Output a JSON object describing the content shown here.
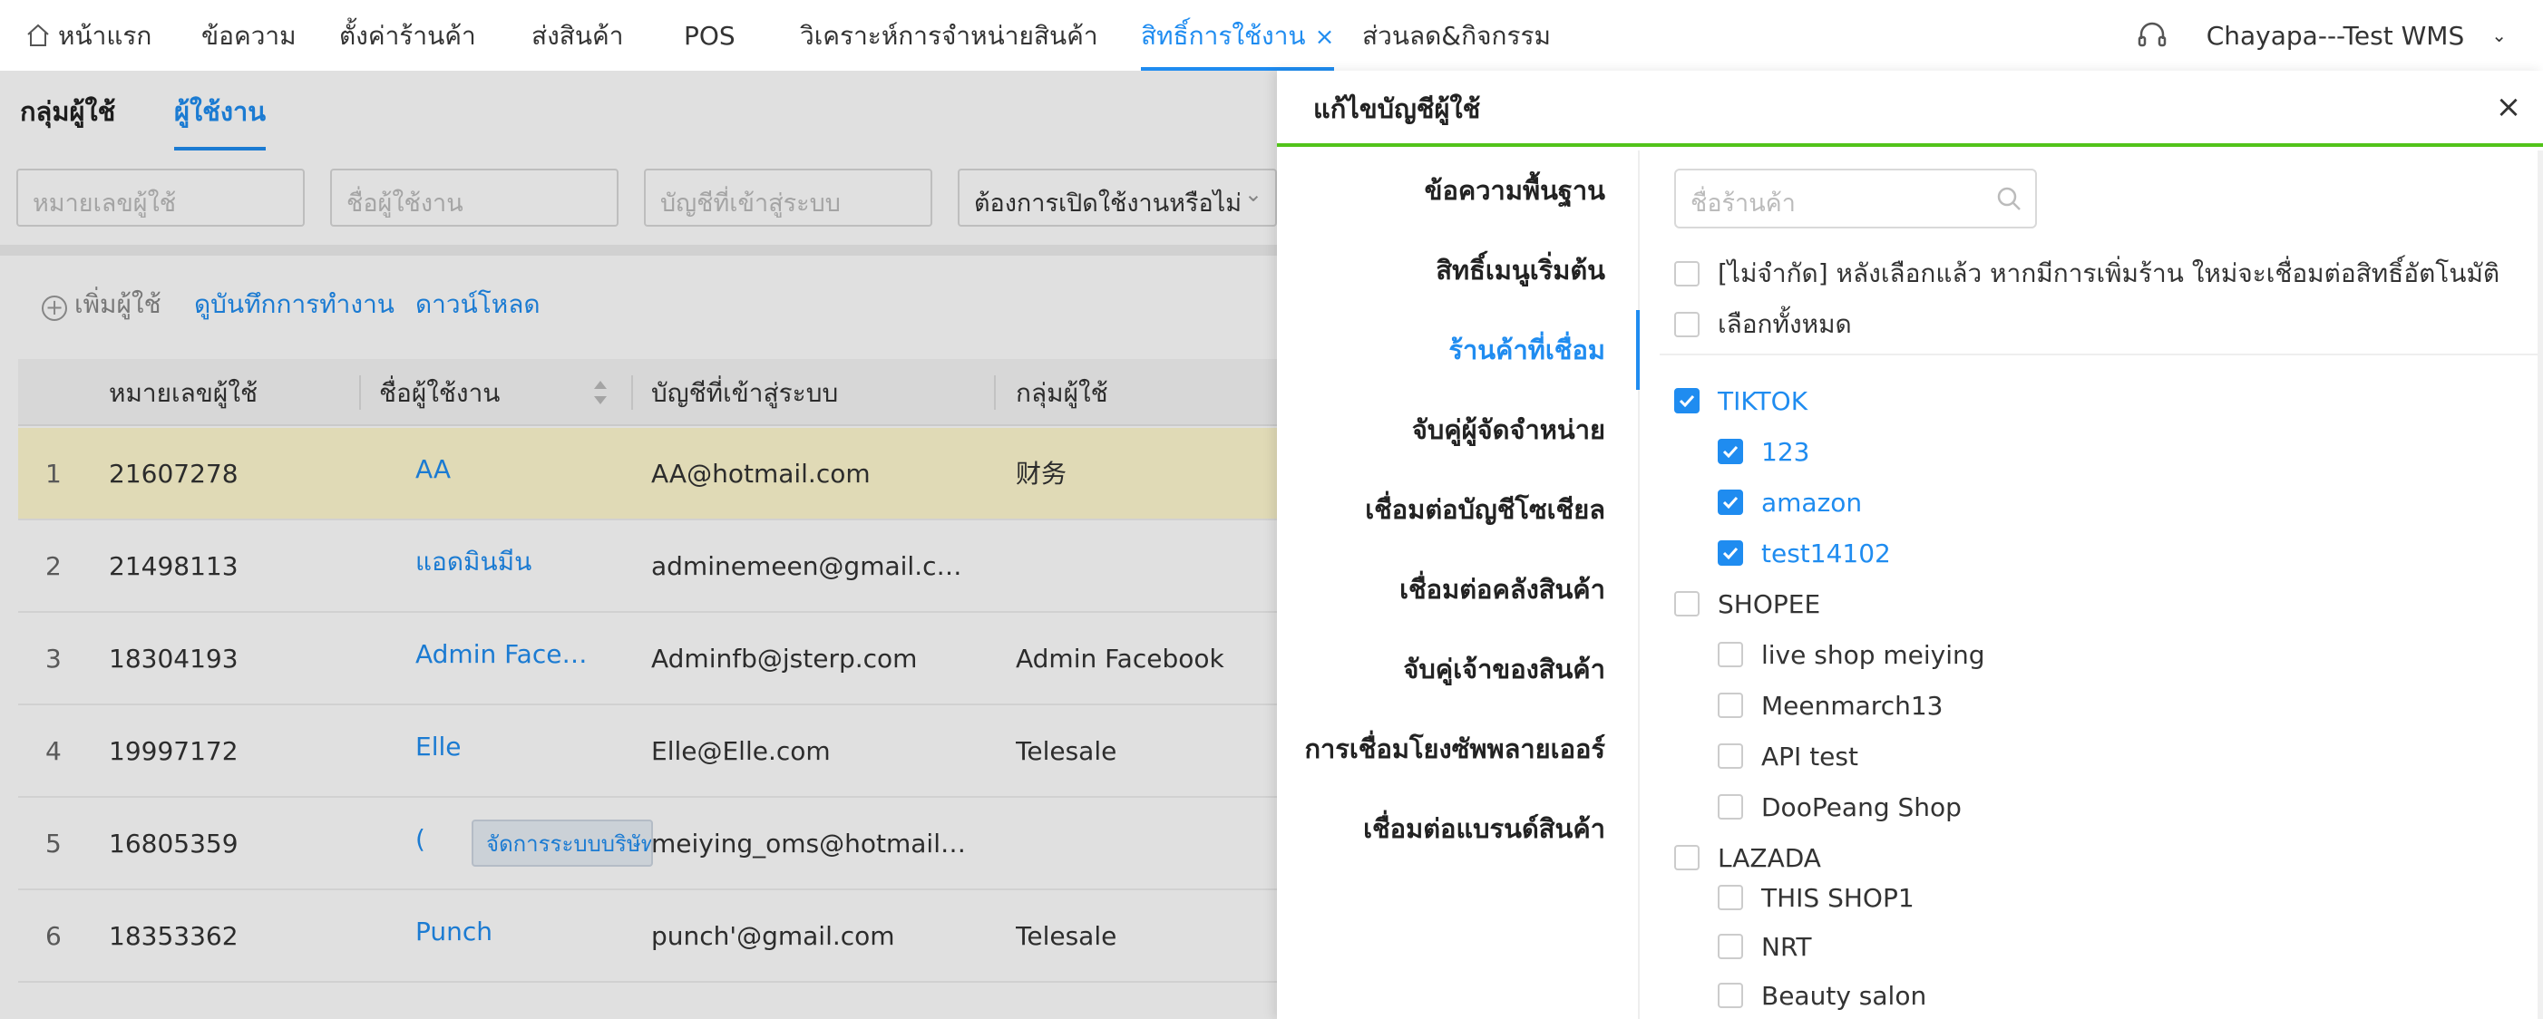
{
  "nav": {
    "home": "หน้าแรก",
    "items": [
      "ข้อความ",
      "ตั้งค่าร้านค้า",
      "ส่งสินค้า",
      "POS",
      "วิเคราะห์การจำหน่ายสินค้า"
    ],
    "active": "สิทธิ์การใช้งาน",
    "active_close": "×",
    "after": "ส่วนลด&กิจกรรม",
    "user": "Chayapa---Test WMS"
  },
  "subtabs": [
    "กลุ่มผู้ใช้",
    "ผู้ใช้งาน"
  ],
  "filters": {
    "user_id_placeholder": "หมายเลขผู้ใช้",
    "user_name_placeholder": "ชื่อผู้ใช้งาน",
    "login_placeholder": "บัญชีที่เข้าสู่ระบบ",
    "enable_select": "ต้องการเปิดใช้งานหรือไม่"
  },
  "actions": {
    "add_user": "เพิ่มผู้ใช้",
    "view_log": "ดูบันทึกการทำงาน",
    "download": "ดาวน์โหลด"
  },
  "table": {
    "headers": [
      "หมายเลขผู้ใช้",
      "ชื่อผู้ใช้งาน",
      "บัญชีที่เข้าสู่ระบบ",
      "กลุ่มผู้ใช้"
    ],
    "rows": [
      {
        "idx": "1",
        "id": "21607278",
        "name": "AA",
        "login": "AA@hotmail.com",
        "group": "财务"
      },
      {
        "idx": "2",
        "id": "21498113",
        "name": "แอดมินมีน",
        "login": "adminemeen@gmail.c…",
        "group": ""
      },
      {
        "idx": "3",
        "id": "18304193",
        "name": "Admin Face…",
        "login": "Adminfb@jsterp.com",
        "group": "Admin Facebook"
      },
      {
        "idx": "4",
        "id": "19997172",
        "name": "Elle",
        "login": "Elle@Elle.com",
        "group": "Telesale"
      },
      {
        "idx": "5",
        "id": "16805359",
        "name": "(",
        "login": "meiying_oms@hotmail…",
        "group": ""
      },
      {
        "idx": "6",
        "id": "18353362",
        "name": "Punch",
        "login": "punch'@gmail.com",
        "group": "Telesale"
      }
    ],
    "tooltip": "จัดการระบบบริษัท"
  },
  "drawer": {
    "title": "แก้ไขบัญชีผู้ใช้",
    "close": "×",
    "menu": [
      "ข้อความพื้นฐาน",
      "สิทธิ์เมนูเริ่มต้น",
      "ร้านค้าที่เชื่อม",
      "จับคู่ผู้จัดจำหน่าย",
      "เชื่อมต่อบัญชีโซเชียล",
      "เชื่อมต่อคลังสินค้า",
      "จับคู่เจ้าของสินค้า",
      "การเชื่อมโยงซัพพลายเออร์",
      "เชื่อมต่อแบรนด์สินค้า"
    ],
    "active_menu_index": 2,
    "search_placeholder": "ชื่อร้านค้า",
    "unlimited": "[ไม่จำกัด] หลังเลือกแล้ว หากมีการเพิ่มร้าน ใหม่จะเชื่อมต่อสิทธิ์อัตโนมัติ",
    "select_all": "เลือกทั้งหมด",
    "platforms": [
      {
        "name": "TIKTOK",
        "checked": true,
        "shops": [
          {
            "name": "123",
            "checked": true
          },
          {
            "name": "amazon",
            "checked": true
          },
          {
            "name": "test14102",
            "checked": true
          }
        ]
      },
      {
        "name": "SHOPEE",
        "checked": false,
        "shops": [
          {
            "name": "live shop meiying",
            "checked": false
          },
          {
            "name": "Meenmarch13",
            "checked": false
          },
          {
            "name": "API test",
            "checked": false
          },
          {
            "name": "DooPeang Shop",
            "checked": false
          }
        ]
      },
      {
        "name": "LAZADA",
        "checked": false,
        "shops": [
          {
            "name": "THIS SHOP1",
            "checked": false
          },
          {
            "name": "NRT",
            "checked": false
          },
          {
            "name": "Beauty salon",
            "checked": false
          }
        ]
      }
    ]
  },
  "colors": {
    "accent": "#1f8cf0",
    "drawer_top_border": "#52c41a",
    "selected_row": "#fff9d0"
  }
}
